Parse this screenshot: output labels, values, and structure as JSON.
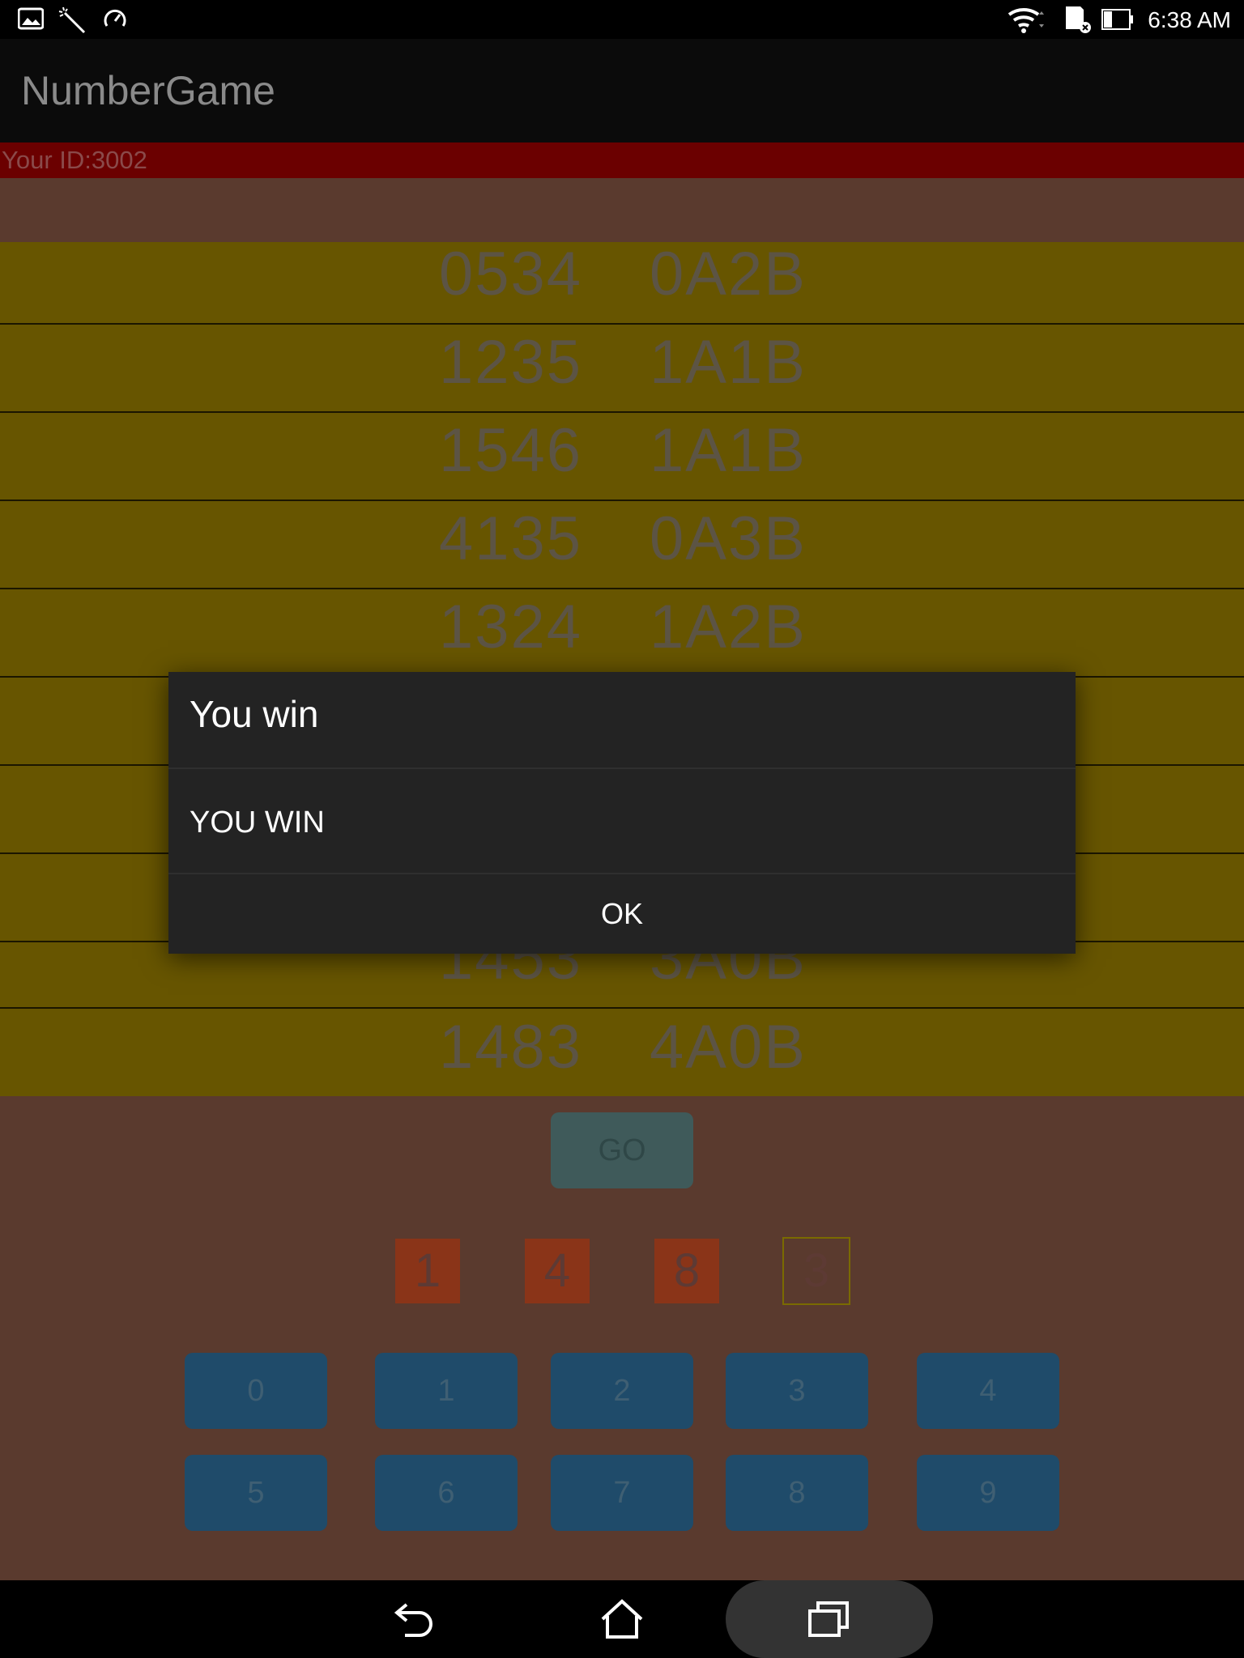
{
  "status_bar": {
    "time": "6:38 AM",
    "icons": [
      "image-icon",
      "magic-wand-icon",
      "speedometer-icon",
      "wifi-icon",
      "sd-card-icon",
      "battery-icon"
    ]
  },
  "app": {
    "title": "NumberGame"
  },
  "player": {
    "id_label": "Your ID:3002"
  },
  "history": [
    {
      "guess": "0534",
      "result": "0A2B"
    },
    {
      "guess": "1235",
      "result": "1A1B"
    },
    {
      "guess": "1546",
      "result": "1A1B"
    },
    {
      "guess": "4135",
      "result": "0A3B"
    },
    {
      "guess": "1324",
      "result": "1A2B"
    },
    {
      "guess": "",
      "result": ""
    },
    {
      "guess": "",
      "result": ""
    },
    {
      "guess": "",
      "result": ""
    },
    {
      "guess": "1453",
      "result": "3A0B"
    },
    {
      "guess": "1483",
      "result": "4A0B"
    }
  ],
  "go_button": {
    "label": "GO"
  },
  "current_guess": [
    "1",
    "4",
    "8",
    "3"
  ],
  "keypad": [
    "0",
    "1",
    "2",
    "3",
    "4",
    "5",
    "6",
    "7",
    "8",
    "9"
  ],
  "dialog": {
    "title": "You win",
    "message": "YOU WIN",
    "ok_label": "OK"
  },
  "colors": {
    "background": "#5a3a2e",
    "history_row": "#675500",
    "id_bar": "#6b0000",
    "slot": "#8a3418",
    "key": "#1f4b6a",
    "dialog": "#232323"
  }
}
